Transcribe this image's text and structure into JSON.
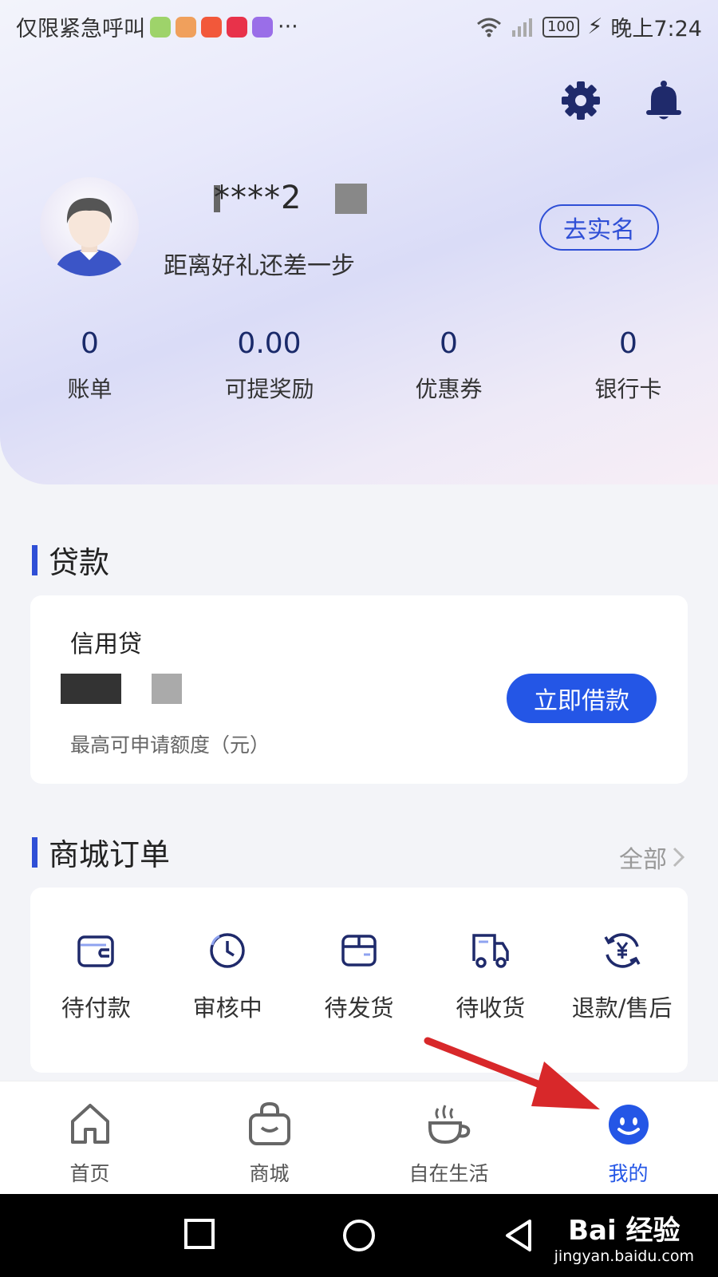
{
  "status_bar": {
    "carrier_text": "仅限紧急呼叫",
    "more": "···",
    "battery": "100",
    "time": "晚上7:24",
    "app_icon_colors": [
      "#9ed36a",
      "#f0a05c",
      "#f2583a",
      "#e8324a",
      "#9a6ee8"
    ]
  },
  "header": {
    "settings_icon": "gear-icon",
    "notification_icon": "bell-icon",
    "user_name": "****2",
    "subtitle": "距离好礼还差一步",
    "realname_button": "去实名"
  },
  "stats": [
    {
      "value": "0",
      "label": "账单"
    },
    {
      "value": "0.00",
      "label": "可提奖励"
    },
    {
      "value": "0",
      "label": "优惠券"
    },
    {
      "value": "0",
      "label": "银行卡"
    }
  ],
  "loan": {
    "section_title": "贷款",
    "product": "信用贷",
    "hint": "最高可申请额度（元）",
    "borrow_button": "立即借款"
  },
  "orders": {
    "section_title": "商城订单",
    "all_link": "全部",
    "items": [
      {
        "label": "待付款",
        "icon": "wallet-icon"
      },
      {
        "label": "审核中",
        "icon": "clock-icon"
      },
      {
        "label": "待发货",
        "icon": "package-icon"
      },
      {
        "label": "待收货",
        "icon": "truck-icon"
      },
      {
        "label": "退款/售后",
        "icon": "refund-icon"
      }
    ]
  },
  "tabbar": [
    {
      "label": "首页",
      "icon": "home-icon"
    },
    {
      "label": "商城",
      "icon": "shopping-bag-icon"
    },
    {
      "label": "自在生活",
      "icon": "coffee-cup-icon"
    },
    {
      "label": "我的",
      "icon": "smiley-icon",
      "active": true
    }
  ],
  "watermark": {
    "main": "Bai 经验",
    "sub": "jingyan.baidu.com"
  },
  "colors": {
    "accent": "#2456e6",
    "annotation_arrow": "#d8282a"
  }
}
